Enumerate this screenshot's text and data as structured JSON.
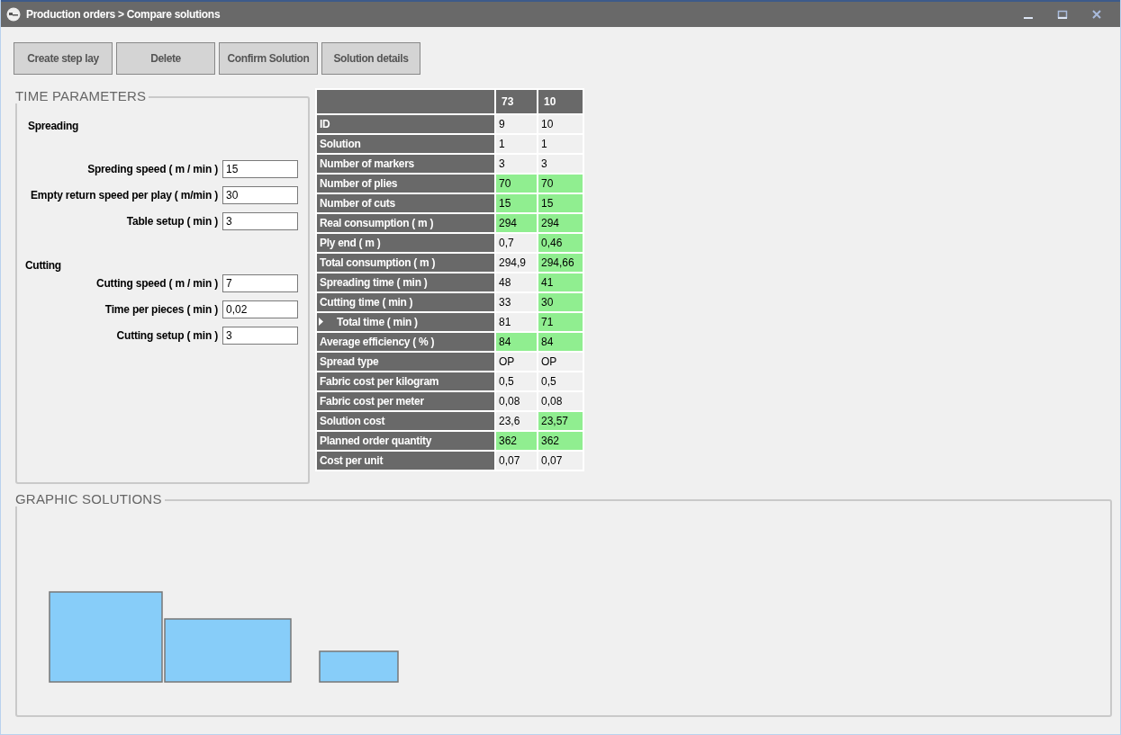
{
  "window": {
    "title": "Production orders > Compare solutions"
  },
  "buttons": [
    "Create step lay",
    "Delete",
    "Confirm Solution",
    "Solution details"
  ],
  "time_parameters": {
    "title": "TIME PARAMETERS",
    "sections": [
      {
        "title": "Spreading",
        "fields": [
          {
            "label": "Spreding speed ( m / min )",
            "value": "15"
          },
          {
            "label": "Empty return speed per play ( m/min )",
            "value": "30"
          },
          {
            "label": "Table setup ( min )",
            "value": "3"
          }
        ]
      },
      {
        "title": "Cutting",
        "fields": [
          {
            "label": "Cutting speed ( m / min )",
            "value": "7"
          },
          {
            "label": "Time per pieces ( min )",
            "value": "0,02"
          },
          {
            "label": "Cutting setup ( min )",
            "value": "3"
          }
        ]
      }
    ]
  },
  "table": {
    "columns": [
      "73",
      "10"
    ],
    "rows": [
      {
        "label": "ID",
        "current": false,
        "cells": [
          {
            "text": "9",
            "highlighted": false
          },
          {
            "text": "10",
            "highlighted": false
          }
        ]
      },
      {
        "label": "Solution",
        "current": false,
        "cells": [
          {
            "text": "1",
            "highlighted": false
          },
          {
            "text": "1",
            "highlighted": false
          }
        ]
      },
      {
        "label": "Number of markers",
        "current": false,
        "cells": [
          {
            "text": "3",
            "highlighted": false
          },
          {
            "text": "3",
            "highlighted": false
          }
        ]
      },
      {
        "label": "Number of plies",
        "current": false,
        "cells": [
          {
            "text": "70",
            "highlighted": true
          },
          {
            "text": "70",
            "highlighted": true
          }
        ]
      },
      {
        "label": "Number of cuts",
        "current": false,
        "cells": [
          {
            "text": "15",
            "highlighted": true
          },
          {
            "text": "15",
            "highlighted": true
          }
        ]
      },
      {
        "label": "Real consumption ( m )",
        "current": false,
        "cells": [
          {
            "text": "294",
            "highlighted": true
          },
          {
            "text": "294",
            "highlighted": true
          }
        ]
      },
      {
        "label": "Ply end ( m )",
        "current": false,
        "cells": [
          {
            "text": "0,7",
            "highlighted": false
          },
          {
            "text": "0,46",
            "highlighted": true
          }
        ]
      },
      {
        "label": "Total consumption  ( m )",
        "current": false,
        "cells": [
          {
            "text": "294,9",
            "highlighted": false
          },
          {
            "text": "294,66",
            "highlighted": true
          }
        ]
      },
      {
        "label": "Spreading time ( min )",
        "current": false,
        "cells": [
          {
            "text": "48",
            "highlighted": false
          },
          {
            "text": "41",
            "highlighted": true
          }
        ]
      },
      {
        "label": "Cutting time ( min )",
        "current": false,
        "cells": [
          {
            "text": "33",
            "highlighted": false
          },
          {
            "text": "30",
            "highlighted": true
          }
        ]
      },
      {
        "label": "Total time ( min )",
        "current": true,
        "cells": [
          {
            "text": "81",
            "highlighted": false
          },
          {
            "text": "71",
            "highlighted": true
          }
        ]
      },
      {
        "label": "Average efficiency ( % )",
        "current": false,
        "cells": [
          {
            "text": "84",
            "highlighted": true
          },
          {
            "text": "84",
            "highlighted": true
          }
        ]
      },
      {
        "label": "Spread type",
        "current": false,
        "cells": [
          {
            "text": "OP",
            "highlighted": false
          },
          {
            "text": "OP",
            "highlighted": false
          }
        ]
      },
      {
        "label": "Fabric cost per kilogram",
        "current": false,
        "cells": [
          {
            "text": "0,5",
            "highlighted": false
          },
          {
            "text": "0,5",
            "highlighted": false
          }
        ]
      },
      {
        "label": "Fabric cost per meter",
        "current": false,
        "cells": [
          {
            "text": "0,08",
            "highlighted": false
          },
          {
            "text": "0,08",
            "highlighted": false
          }
        ]
      },
      {
        "label": "Solution cost",
        "current": false,
        "cells": [
          {
            "text": "23,6",
            "highlighted": false
          },
          {
            "text": "23,57",
            "highlighted": true
          }
        ]
      },
      {
        "label": "Planned order quantity",
        "current": false,
        "cells": [
          {
            "text": "362",
            "highlighted": true
          },
          {
            "text": "362",
            "highlighted": true
          }
        ]
      },
      {
        "label": "Cost per unit",
        "current": false,
        "cells": [
          {
            "text": "0,07",
            "highlighted": false
          },
          {
            "text": "0,07",
            "highlighted": false
          }
        ]
      }
    ]
  },
  "graphic_solutions": {
    "title": "GRAPHIC SOLUTIONS"
  }
}
